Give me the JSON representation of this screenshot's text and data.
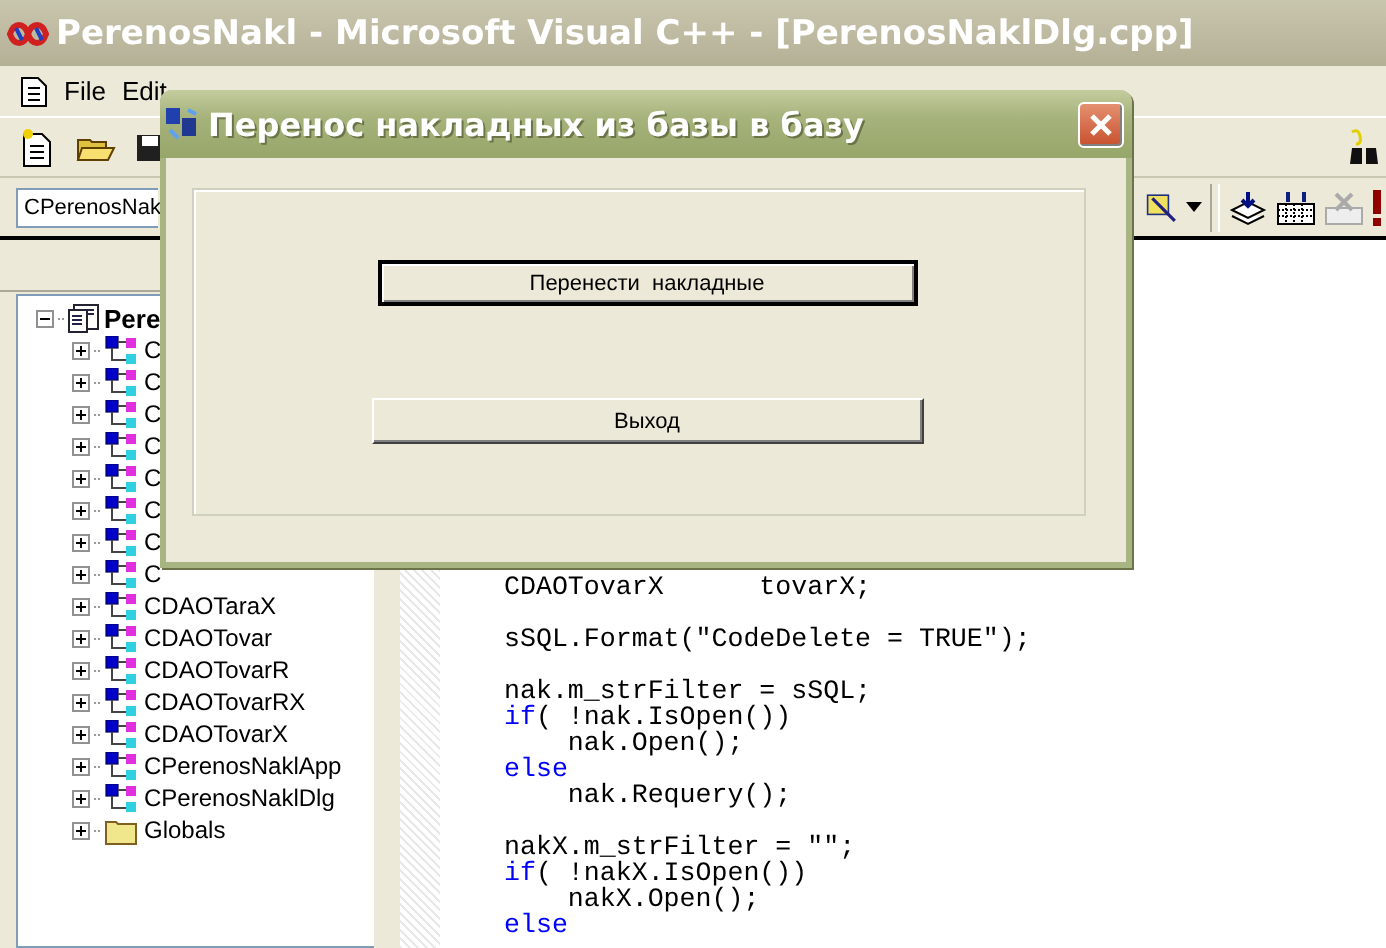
{
  "window": {
    "title": "PerenosNakl - Microsoft Visual C++ - [PerenosNaklDlg.cpp]"
  },
  "menu": [
    {
      "label": "File"
    },
    {
      "label": "Edit"
    }
  ],
  "class_combo": {
    "value": "CPerenosNak"
  },
  "class_tree": {
    "label": "Pere",
    "kind": "workspace",
    "expanded": true,
    "children": [
      {
        "label": "C",
        "kind": "class",
        "expanded": false
      },
      {
        "label": "C",
        "kind": "class",
        "expanded": false
      },
      {
        "label": "C",
        "kind": "class",
        "expanded": false
      },
      {
        "label": "C",
        "kind": "class",
        "expanded": false
      },
      {
        "label": "C",
        "kind": "class",
        "expanded": false
      },
      {
        "label": "C",
        "kind": "class",
        "expanded": false
      },
      {
        "label": "C",
        "kind": "class",
        "expanded": false
      },
      {
        "label": "C",
        "kind": "class",
        "expanded": false
      },
      {
        "label": "CDAOTaraX",
        "kind": "class",
        "expanded": false
      },
      {
        "label": "CDAOTovar",
        "kind": "class",
        "expanded": false
      },
      {
        "label": "CDAOTovarR",
        "kind": "class",
        "expanded": false
      },
      {
        "label": "CDAOTovarRX",
        "kind": "class",
        "expanded": false
      },
      {
        "label": "CDAOTovarX",
        "kind": "class",
        "expanded": false
      },
      {
        "label": "CPerenosNaklApp",
        "kind": "class",
        "expanded": false
      },
      {
        "label": "CPerenosNaklDlg",
        "kind": "class",
        "expanded": false
      },
      {
        "label": "Globals",
        "kind": "folder",
        "expanded": false
      }
    ]
  },
  "code_lines": [
    {
      "kind": "code",
      "segments": [
        {
          "kind": "plain",
          "text": "CDAOTovarX      tovarX;"
        }
      ]
    },
    {
      "kind": "blank"
    },
    {
      "kind": "code",
      "segments": [
        {
          "kind": "plain",
          "text": "sSQL.Format(\"CodeDelete = TRUE\");"
        }
      ]
    },
    {
      "kind": "blank"
    },
    {
      "kind": "code",
      "segments": [
        {
          "kind": "plain",
          "text": "nak.m_strFilter = sSQL;"
        }
      ]
    },
    {
      "kind": "code",
      "segments": [
        {
          "kind": "keyword",
          "text": "if"
        },
        {
          "kind": "plain",
          "text": "( !nak.IsOpen())"
        }
      ]
    },
    {
      "kind": "code",
      "segments": [
        {
          "kind": "plain",
          "text": "    nak.Open();"
        }
      ]
    },
    {
      "kind": "code",
      "segments": [
        {
          "kind": "keyword",
          "text": "else"
        }
      ]
    },
    {
      "kind": "code",
      "segments": [
        {
          "kind": "plain",
          "text": "    nak.Requery();"
        }
      ]
    },
    {
      "kind": "blank"
    },
    {
      "kind": "code",
      "segments": [
        {
          "kind": "plain",
          "text": "nakX.m_strFilter = \"\";"
        }
      ]
    },
    {
      "kind": "code",
      "segments": [
        {
          "kind": "keyword",
          "text": "if"
        },
        {
          "kind": "plain",
          "text": "( !nakX.IsOpen())"
        }
      ]
    },
    {
      "kind": "code",
      "segments": [
        {
          "kind": "plain",
          "text": "    nakX.Open();"
        }
      ]
    },
    {
      "kind": "code",
      "segments": [
        {
          "kind": "keyword",
          "text": "else"
        }
      ]
    }
  ],
  "dialog": {
    "title": "Перенос накладных из базы в базу",
    "buttons": [
      {
        "label": "Перенести  накладные"
      },
      {
        "label": "Выход"
      }
    ]
  }
}
